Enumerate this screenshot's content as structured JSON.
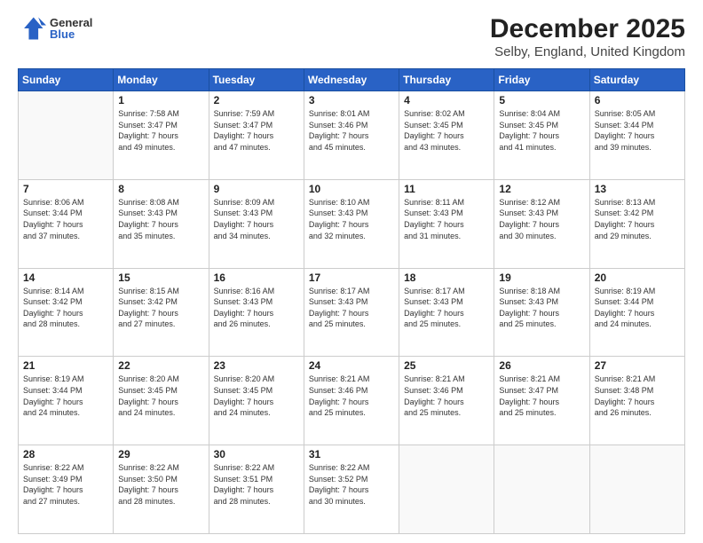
{
  "logo": {
    "general": "General",
    "blue": "Blue"
  },
  "header": {
    "title": "December 2025",
    "subtitle": "Selby, England, United Kingdom"
  },
  "calendar": {
    "days_of_week": [
      "Sunday",
      "Monday",
      "Tuesday",
      "Wednesday",
      "Thursday",
      "Friday",
      "Saturday"
    ],
    "weeks": [
      [
        {
          "day": "",
          "info": ""
        },
        {
          "day": "1",
          "info": "Sunrise: 7:58 AM\nSunset: 3:47 PM\nDaylight: 7 hours\nand 49 minutes."
        },
        {
          "day": "2",
          "info": "Sunrise: 7:59 AM\nSunset: 3:47 PM\nDaylight: 7 hours\nand 47 minutes."
        },
        {
          "day": "3",
          "info": "Sunrise: 8:01 AM\nSunset: 3:46 PM\nDaylight: 7 hours\nand 45 minutes."
        },
        {
          "day": "4",
          "info": "Sunrise: 8:02 AM\nSunset: 3:45 PM\nDaylight: 7 hours\nand 43 minutes."
        },
        {
          "day": "5",
          "info": "Sunrise: 8:04 AM\nSunset: 3:45 PM\nDaylight: 7 hours\nand 41 minutes."
        },
        {
          "day": "6",
          "info": "Sunrise: 8:05 AM\nSunset: 3:44 PM\nDaylight: 7 hours\nand 39 minutes."
        }
      ],
      [
        {
          "day": "7",
          "info": "Sunrise: 8:06 AM\nSunset: 3:44 PM\nDaylight: 7 hours\nand 37 minutes."
        },
        {
          "day": "8",
          "info": "Sunrise: 8:08 AM\nSunset: 3:43 PM\nDaylight: 7 hours\nand 35 minutes."
        },
        {
          "day": "9",
          "info": "Sunrise: 8:09 AM\nSunset: 3:43 PM\nDaylight: 7 hours\nand 34 minutes."
        },
        {
          "day": "10",
          "info": "Sunrise: 8:10 AM\nSunset: 3:43 PM\nDaylight: 7 hours\nand 32 minutes."
        },
        {
          "day": "11",
          "info": "Sunrise: 8:11 AM\nSunset: 3:43 PM\nDaylight: 7 hours\nand 31 minutes."
        },
        {
          "day": "12",
          "info": "Sunrise: 8:12 AM\nSunset: 3:43 PM\nDaylight: 7 hours\nand 30 minutes."
        },
        {
          "day": "13",
          "info": "Sunrise: 8:13 AM\nSunset: 3:42 PM\nDaylight: 7 hours\nand 29 minutes."
        }
      ],
      [
        {
          "day": "14",
          "info": "Sunrise: 8:14 AM\nSunset: 3:42 PM\nDaylight: 7 hours\nand 28 minutes."
        },
        {
          "day": "15",
          "info": "Sunrise: 8:15 AM\nSunset: 3:42 PM\nDaylight: 7 hours\nand 27 minutes."
        },
        {
          "day": "16",
          "info": "Sunrise: 8:16 AM\nSunset: 3:43 PM\nDaylight: 7 hours\nand 26 minutes."
        },
        {
          "day": "17",
          "info": "Sunrise: 8:17 AM\nSunset: 3:43 PM\nDaylight: 7 hours\nand 25 minutes."
        },
        {
          "day": "18",
          "info": "Sunrise: 8:17 AM\nSunset: 3:43 PM\nDaylight: 7 hours\nand 25 minutes."
        },
        {
          "day": "19",
          "info": "Sunrise: 8:18 AM\nSunset: 3:43 PM\nDaylight: 7 hours\nand 25 minutes."
        },
        {
          "day": "20",
          "info": "Sunrise: 8:19 AM\nSunset: 3:44 PM\nDaylight: 7 hours\nand 24 minutes."
        }
      ],
      [
        {
          "day": "21",
          "info": "Sunrise: 8:19 AM\nSunset: 3:44 PM\nDaylight: 7 hours\nand 24 minutes."
        },
        {
          "day": "22",
          "info": "Sunrise: 8:20 AM\nSunset: 3:45 PM\nDaylight: 7 hours\nand 24 minutes."
        },
        {
          "day": "23",
          "info": "Sunrise: 8:20 AM\nSunset: 3:45 PM\nDaylight: 7 hours\nand 24 minutes."
        },
        {
          "day": "24",
          "info": "Sunrise: 8:21 AM\nSunset: 3:46 PM\nDaylight: 7 hours\nand 25 minutes."
        },
        {
          "day": "25",
          "info": "Sunrise: 8:21 AM\nSunset: 3:46 PM\nDaylight: 7 hours\nand 25 minutes."
        },
        {
          "day": "26",
          "info": "Sunrise: 8:21 AM\nSunset: 3:47 PM\nDaylight: 7 hours\nand 25 minutes."
        },
        {
          "day": "27",
          "info": "Sunrise: 8:21 AM\nSunset: 3:48 PM\nDaylight: 7 hours\nand 26 minutes."
        }
      ],
      [
        {
          "day": "28",
          "info": "Sunrise: 8:22 AM\nSunset: 3:49 PM\nDaylight: 7 hours\nand 27 minutes."
        },
        {
          "day": "29",
          "info": "Sunrise: 8:22 AM\nSunset: 3:50 PM\nDaylight: 7 hours\nand 28 minutes."
        },
        {
          "day": "30",
          "info": "Sunrise: 8:22 AM\nSunset: 3:51 PM\nDaylight: 7 hours\nand 28 minutes."
        },
        {
          "day": "31",
          "info": "Sunrise: 8:22 AM\nSunset: 3:52 PM\nDaylight: 7 hours\nand 30 minutes."
        },
        {
          "day": "",
          "info": ""
        },
        {
          "day": "",
          "info": ""
        },
        {
          "day": "",
          "info": ""
        }
      ]
    ]
  }
}
